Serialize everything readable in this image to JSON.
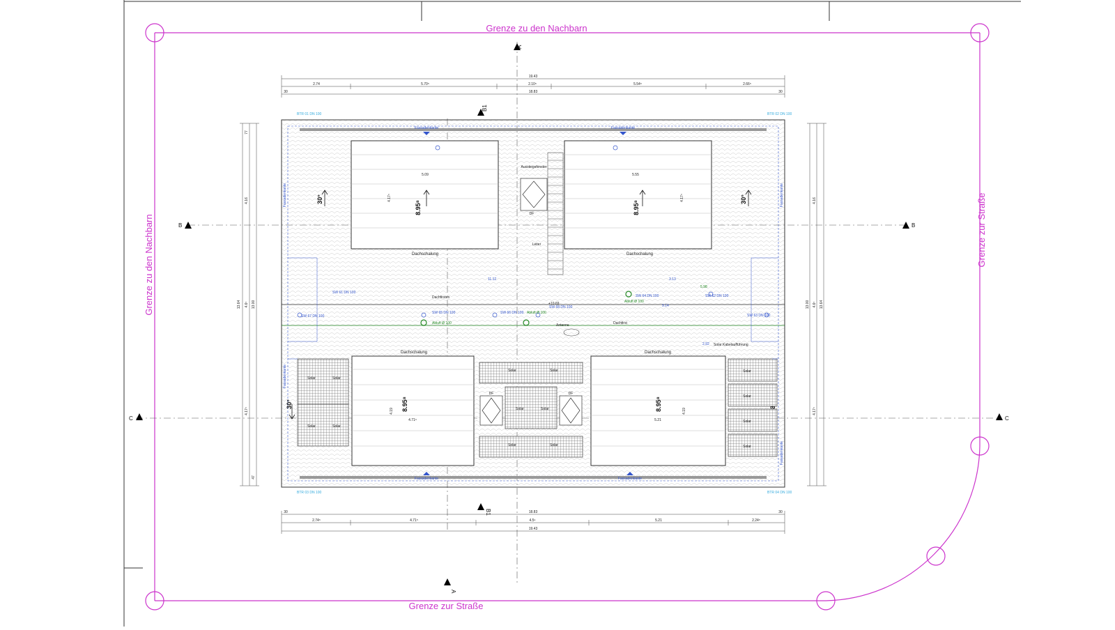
{
  "boundaries": {
    "top": "Grenze zu den Nachbarn",
    "left": "Grenze zu den Nachbarn",
    "bottom": "Grenze zur Straße",
    "right": "Grenze zur Straße"
  },
  "section_markers": {
    "a_top": "A",
    "a_bottom": "A",
    "b_left": "B",
    "b_right": "B",
    "c_left": "C",
    "c_right": "C",
    "b1_top": "B1",
    "b1_bottom": "B1"
  },
  "dims_top": {
    "total": "19.43",
    "row": [
      "2.74",
      "5.70⁵",
      "2.10⁵",
      "5.54⁵",
      "2.66⁵"
    ],
    "inner": "18.83",
    "left_end": "30",
    "right_end": "30"
  },
  "dims_bottom": {
    "total": "19.43",
    "row": [
      "2.74⁵",
      "4.71⁵",
      "4.5⁹",
      "5.21",
      "2.24⁵"
    ],
    "inner": "18.83",
    "left_end": "30",
    "right_end": "30"
  },
  "dims_side": {
    "total": "13.64",
    "inner": "13.00",
    "a": "4.16",
    "b": "4.6⁵",
    "c": "4.17⁵",
    "d": "47",
    "e": "77"
  },
  "roof": {
    "top_left_shell": "Dachschalung",
    "top_right_shell": "Dachschalung",
    "bottom_left_shell": "Dachschalung",
    "bottom_right_shell": "Dachschalung",
    "ridge": "Dachfirst",
    "ridge2": "Dachfirsten",
    "ladder": "Leiter",
    "hatch": "Ausstiegsfenster",
    "df": "DF",
    "antenna": "Antenne",
    "kabel": "Solar Kabelaufführung",
    "elevation": "+10.69",
    "facade_edge": "Fassadenkante",
    "pitch_top_left": "30°",
    "pitch_top_right": "30°",
    "pitch_bottom_left": "30°",
    "pitch_bottom_right": "30°",
    "eave_top_left": "8.95⁸",
    "eave_top_right": "8.95⁸",
    "eave_bottom_left": "8.95⁸",
    "eave_bottom_right": "8.95⁸",
    "w_top_left": "5.09",
    "w_top_right": "5.55",
    "w_bottom_left": "4.71⁵",
    "w_bottom_right": "5.21",
    "h_top": "4.17⁵",
    "h_bottom": "4.19",
    "mid_a": "11.12",
    "mid_b": "3.13",
    "mid_c": "9.14",
    "mid_d": "5.98",
    "mid_e": "2.92"
  },
  "solar_label": "Solar",
  "drains": [
    "SW 61 DN 100",
    "SW 62 DN 100",
    "SW 63 DN 100",
    "SW 64 DN 100",
    "SW 65 DN 100",
    "SW 66 DN 100",
    "SW 67 DN 100",
    "SW 68 DN 100"
  ],
  "abluft": "Abluft Ø 100",
  "corner_tags": {
    "tl": "BTR 01 DN 100",
    "tr": "BTR 02 DN 100",
    "bl": "BTR 03 DN 100",
    "br": "BTR 04 DN 100"
  },
  "colors": {
    "boundary": "#cc33cc",
    "dimension": "#3355cc",
    "green": "#228822",
    "line": "#222222"
  }
}
